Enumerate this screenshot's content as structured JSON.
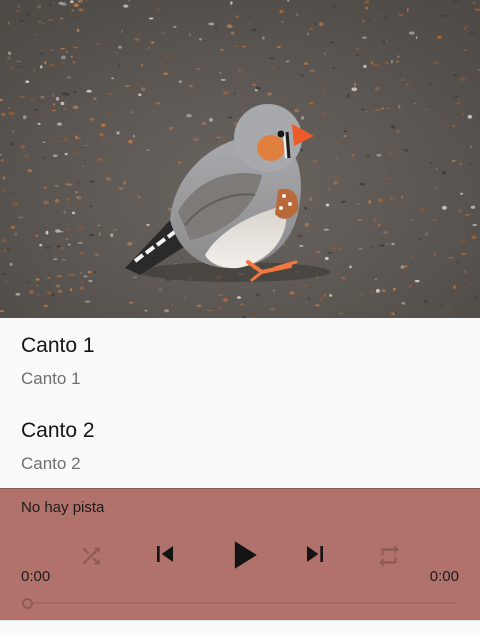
{
  "hero": {
    "image": "zebra-finch-photo"
  },
  "tracks": [
    {
      "title": "Canto 1",
      "subtitle": "Canto 1"
    },
    {
      "title": "Canto 2",
      "subtitle": "Canto 2"
    }
  ],
  "player": {
    "track_name": "No hay pista",
    "elapsed": "0:00",
    "duration": "0:00",
    "progress": 0,
    "controls": [
      "shuffle-icon",
      "skip-previous-icon",
      "play-icon",
      "skip-next-icon",
      "repeat-icon"
    ],
    "colors": {
      "background": "#b2726c",
      "disabled_icon": "#8d5a55",
      "active_icon": "#141414"
    }
  }
}
